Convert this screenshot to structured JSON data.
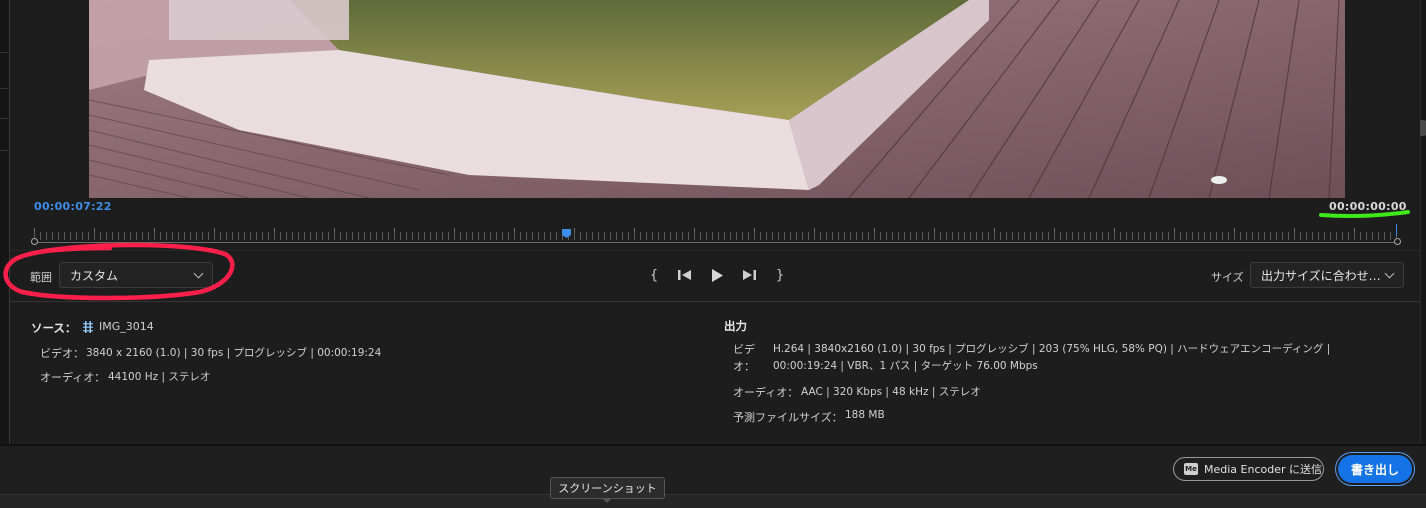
{
  "timecodes": {
    "current": "00:00:07:22",
    "duration": "00:00:00:00"
  },
  "controls": {
    "range_label": "範囲",
    "range_value": "カスタム",
    "size_label": "サイズ",
    "size_value": "出力サイズに合わせ…"
  },
  "transport": {
    "mark_in": "{",
    "step_back": "step-back-icon",
    "play": "play-icon",
    "step_forward": "step-forward-icon",
    "mark_out": "}"
  },
  "source": {
    "heading": "ソース：",
    "file_name": "IMG_3014",
    "video_label": "ビデオ：",
    "video_value": "3840 x 2160 (1.0) | 30 fps | プログレッシブ | 00:00:19:24",
    "audio_label": "オーディオ：",
    "audio_value": "44100 Hz | ステレオ"
  },
  "output": {
    "heading": "出力",
    "video_label": "ビデオ：",
    "video_value": "H.264 | 3840x2160 (1.0) | 30 fps | プログレッシブ | 203 (75% HLG, 58% PQ) | ハードウェアエンコーディング | 00:00:19:24 | VBR、1 パス | ターゲット 76.00 Mbps",
    "audio_label": "オーディオ：",
    "audio_value": "AAC | 320 Kbps | 48 kHz | ステレオ",
    "file_size_label": "予測ファイルサイズ：",
    "file_size_value": "188 MB"
  },
  "buttons": {
    "media_encoder_badge": "Me",
    "media_encoder": "Media Encoder に送信",
    "export": "書き出し"
  },
  "tooltip": "スクリーンショット",
  "colors": {
    "accent_blue": "#1473e6",
    "playhead_blue": "#3d8ee8",
    "annotation_red": "#ff1f4b",
    "annotation_green": "#3ee81a"
  }
}
